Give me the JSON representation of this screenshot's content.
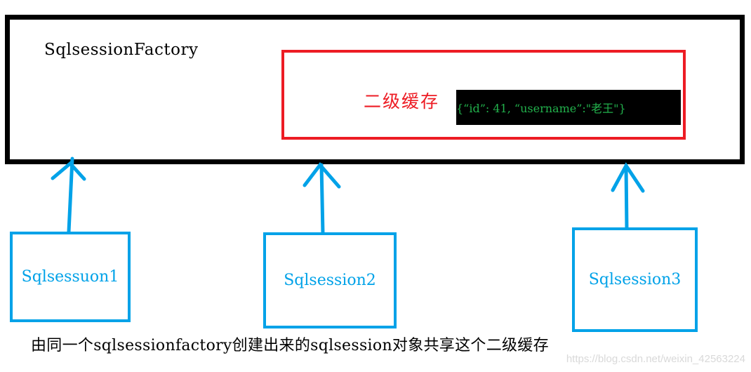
{
  "factory": {
    "title": "SqlsessionFactory",
    "border_color": "#000000"
  },
  "cache": {
    "label": "二级缓存",
    "border_color": "#ed1c24",
    "entry": "{“id”: 41, “username”:\"老王\"}",
    "entry_color": "#22b14c",
    "entry_background": "#000000"
  },
  "sessions": [
    {
      "label": "Sqlsessuon1"
    },
    {
      "label": "Sqlsession2"
    },
    {
      "label": "Sqlsession3"
    }
  ],
  "session_color": "#00a2e8",
  "arrow_icon": "arrow-up-icon",
  "caption": "由同一个sqlsessionfactory创建出来的sqlsession对象共享这个二级缓存",
  "watermark": "https://blog.csdn.net/weixin_42563224"
}
